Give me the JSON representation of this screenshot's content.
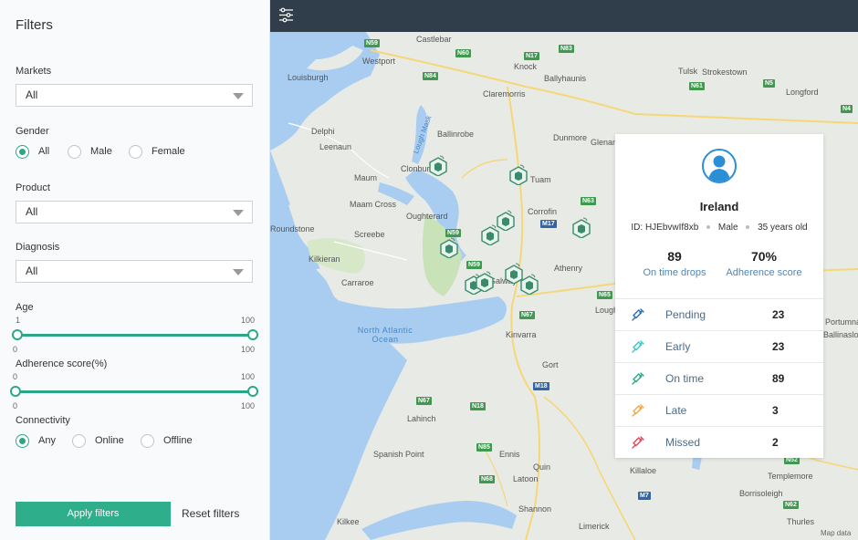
{
  "sidebar": {
    "title": "Filters",
    "markets": {
      "label": "Markets",
      "value": "All"
    },
    "gender": {
      "label": "Gender",
      "options": [
        "All",
        "Male",
        "Female"
      ],
      "selected": "All"
    },
    "product": {
      "label": "Product",
      "value": "All"
    },
    "diagnosis": {
      "label": "Diagnosis",
      "value": "All"
    },
    "age": {
      "label": "Age",
      "min": "1",
      "max": "100",
      "low": "0",
      "high": "100"
    },
    "adherence": {
      "label": "Adherence score(%)",
      "min": "0",
      "max": "100",
      "low": "0",
      "high": "100"
    },
    "connectivity": {
      "label": "Connectivity",
      "options": [
        "Any",
        "Online",
        "Offline"
      ],
      "selected": "Any"
    },
    "apply_label": "Apply filters",
    "reset_label": "Reset filters"
  },
  "map": {
    "places": [
      "Castlebar",
      "Westport",
      "Louisburgh",
      "Knock",
      "Ballyhaunis",
      "Tulsk",
      "Strokestown",
      "Claremorris",
      "Ballinrobe",
      "Delphi",
      "Leenaun",
      "Clonbur",
      "Maum",
      "Dunmore",
      "Glenamaddy",
      "Tuam",
      "Longford",
      "Maam Cross",
      "Oughterard",
      "Corrofin",
      "Roundstone",
      "Screebe",
      "Kilkieran",
      "Carraroe",
      "Athenry",
      "Loughrea",
      "Galway",
      "Kinvarra",
      "Gort",
      "Lahinch",
      "Spanish Point",
      "Ennis",
      "Quin",
      "Latoon",
      "Shannon",
      "Kilkee",
      "Limerick",
      "Killaloe",
      "Templemore",
      "Borrisoleigh",
      "Thurles",
      "Portumna",
      "Ballinasloe"
    ],
    "sea_label": "North Atlantic Ocean",
    "lake_label": "Lough Mask",
    "roads": [
      "N59",
      "N60",
      "N83",
      "N17",
      "N84",
      "N5",
      "N63",
      "N61",
      "N4",
      "M17",
      "N65",
      "N67",
      "N18",
      "M18",
      "N85",
      "N68",
      "M7",
      "N62",
      "N52",
      "N6"
    ],
    "attribution": "Map data"
  },
  "panel": {
    "name": "Ireland",
    "id_text": "ID: HJEbvwIf8xb",
    "gender": "Male",
    "age": "35 years old",
    "stats": [
      {
        "num": "89",
        "label": "On time drops"
      },
      {
        "num": "70%",
        "label": "Adherence score"
      }
    ],
    "statuses": [
      {
        "name": "Pending",
        "count": "23",
        "color": "#2a6db3"
      },
      {
        "name": "Early",
        "count": "23",
        "color": "#3cc7c1"
      },
      {
        "name": "On time",
        "count": "89",
        "color": "#2aa886"
      },
      {
        "name": "Late",
        "count": "3",
        "color": "#f0a54b"
      },
      {
        "name": "Missed",
        "count": "2",
        "color": "#e2475b"
      }
    ]
  },
  "colors": {
    "accent": "#2eae8a",
    "topbar": "#2f3e4a",
    "water": "#a9cdf0",
    "land": "#e8eae6",
    "green_land": "#c9e2b8"
  }
}
